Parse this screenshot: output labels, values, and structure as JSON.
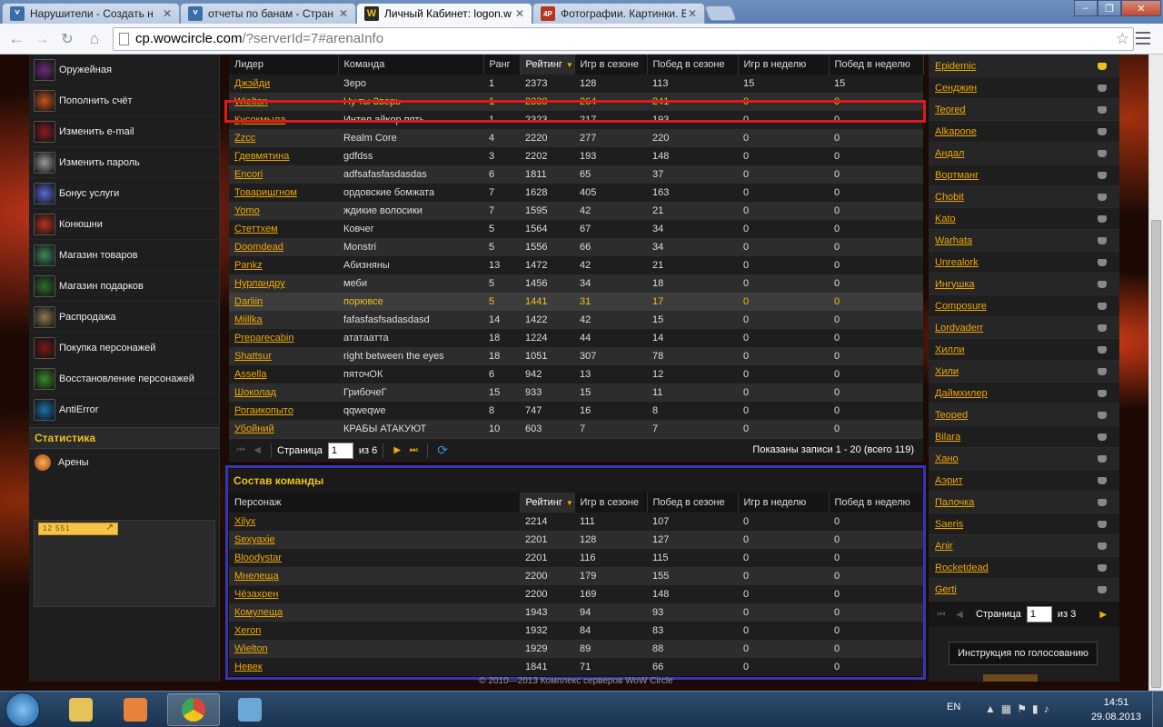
{
  "browser": {
    "tabs": [
      {
        "title": "Нарушители - Создать н",
        "favicon": "wowcircle-icon",
        "active": false
      },
      {
        "title": "отчеты по банам - Стран",
        "favicon": "wowcircle-icon",
        "active": false
      },
      {
        "title": "Личный Кабинет: logon.w",
        "favicon": "wow-icon",
        "active": true
      },
      {
        "title": "Фотографии. Картинки. В",
        "favicon": "4put-icon",
        "active": false
      }
    ],
    "url_host": "cp.wowcircle.com",
    "url_path": "/?serverId=7#arenaInfo",
    "window_controls": {
      "minimize": "‒",
      "maximize": "❐",
      "close": "✕"
    }
  },
  "left_menu": {
    "items": [
      {
        "label": "Оружейная",
        "icon": "armory-icon",
        "color": "#6b2d7a"
      },
      {
        "label": "Пополнить счёт",
        "icon": "topup-icon",
        "color": "#c4571a"
      },
      {
        "label": "Изменить e-mail",
        "icon": "email-icon",
        "color": "#8a1c1c"
      },
      {
        "label": "Изменить пароль",
        "icon": "password-icon",
        "color": "#9a9a9a"
      },
      {
        "label": "Бонус услуги",
        "icon": "bonus-icon",
        "color": "#5b6bd8"
      },
      {
        "label": "Конюшни",
        "icon": "stable-icon",
        "color": "#b8351c"
      },
      {
        "label": "Магазин товаров",
        "icon": "shop-icon",
        "color": "#3e8a5a"
      },
      {
        "label": "Магазин подарков",
        "icon": "gift-icon",
        "color": "#2f6e2a"
      },
      {
        "label": "Распродажа",
        "icon": "sale-icon",
        "color": "#8c7a55"
      },
      {
        "label": "Покупка персонажей",
        "icon": "buy-character-icon",
        "color": "#7a1a1a"
      },
      {
        "label": "Восстановление персонажей",
        "icon": "restore-character-icon",
        "color": "#3b8a2a"
      },
      {
        "label": "AntiError",
        "icon": "antierror-icon",
        "color": "#1f6fa8"
      }
    ],
    "section_title": "Статистика",
    "sub_items": [
      {
        "label": "Арены",
        "icon": "arena-icon"
      }
    ],
    "counter_text": "12 551"
  },
  "teams_table": {
    "columns": [
      "Лидер",
      "Команда",
      "Ранг",
      "Рейтинг",
      "Игр в сезоне",
      "Побед в сезоне",
      "Игр в неделю",
      "Побед в неделю"
    ],
    "sorted_column": "Рейтинг",
    "rows": [
      [
        "Джэйди",
        "Зеро",
        "1",
        "2373",
        "128",
        "113",
        "15",
        "15"
      ],
      [
        "Wielton",
        "Ну ты Зверь",
        "1",
        "2330",
        "264",
        "241",
        "0",
        "0"
      ],
      [
        "Кусокмыла",
        "Интел айкор пять",
        "1",
        "2323",
        "217",
        "193",
        "0",
        "0"
      ],
      [
        "Zzcc",
        "Realm Core",
        "4",
        "2220",
        "277",
        "220",
        "0",
        "0"
      ],
      [
        "Гдевмятина",
        "gdfdss",
        "3",
        "2202",
        "193",
        "148",
        "0",
        "0"
      ],
      [
        "Encori",
        "adfsafasfasdasdas",
        "6",
        "1811",
        "65",
        "37",
        "0",
        "0"
      ],
      [
        "Товарищгном",
        "ордовские бомжата",
        "7",
        "1628",
        "405",
        "163",
        "0",
        "0"
      ],
      [
        "Yomo",
        "ждикие волосики",
        "7",
        "1595",
        "42",
        "21",
        "0",
        "0"
      ],
      [
        "Стеттхем",
        "Ковчег",
        "5",
        "1564",
        "67",
        "34",
        "0",
        "0"
      ],
      [
        "Doomdead",
        "Monstri",
        "5",
        "1556",
        "66",
        "34",
        "0",
        "0"
      ],
      [
        "Pankz",
        "Абизняны",
        "13",
        "1472",
        "42",
        "21",
        "0",
        "0"
      ],
      [
        "Нурландру",
        "меби",
        "5",
        "1456",
        "34",
        "18",
        "0",
        "0"
      ],
      [
        "Darliin",
        "порювсе",
        "5",
        "1441",
        "31",
        "17",
        "0",
        "0"
      ],
      [
        "Miillka",
        "fafasfasfsadasdasd",
        "14",
        "1422",
        "42",
        "15",
        "0",
        "0"
      ],
      [
        "Preparecabin",
        "ататаатта",
        "18",
        "1224",
        "44",
        "14",
        "0",
        "0"
      ],
      [
        "Shattsur",
        "right between the eyes",
        "18",
        "1051",
        "307",
        "78",
        "0",
        "0"
      ],
      [
        "Assella",
        "пяточОК",
        "6",
        "942",
        "13",
        "12",
        "0",
        "0"
      ],
      [
        "Шоколад",
        "ГрибочеГ",
        "15",
        "933",
        "15",
        "11",
        "0",
        "0"
      ],
      [
        "Рогаикопыто",
        "qqweqwe",
        "8",
        "747",
        "16",
        "8",
        "0",
        "0"
      ],
      [
        "Убойний",
        "КРАБЫ АТАКУЮТ",
        "10",
        "603",
        "7",
        "7",
        "0",
        "0"
      ]
    ],
    "highlighted_row_index": 12,
    "pager": {
      "page_label": "Страница",
      "page_value": "1",
      "of_label": "из 6",
      "total_label": "Показаны записи 1 - 20 (всего 119)"
    }
  },
  "composition": {
    "title": "Состав команды",
    "columns": [
      "Персонаж",
      "Рейтинг",
      "Игр в сезоне",
      "Побед в сезоне",
      "Игр в неделю",
      "Побед в неделю"
    ],
    "sorted_column": "Рейтинг",
    "rows": [
      [
        "Xilyx",
        "2214",
        "111",
        "107",
        "0",
        "0"
      ],
      [
        "Sexyaxie",
        "2201",
        "128",
        "127",
        "0",
        "0"
      ],
      [
        "Bloodystar",
        "2201",
        "116",
        "115",
        "0",
        "0"
      ],
      [
        "Мнелеща",
        "2200",
        "179",
        "155",
        "0",
        "0"
      ],
      [
        "Чёзахрен",
        "2200",
        "169",
        "148",
        "0",
        "0"
      ],
      [
        "Комулеща",
        "1943",
        "94",
        "93",
        "0",
        "0"
      ],
      [
        "Xeron",
        "1932",
        "84",
        "83",
        "0",
        "0"
      ],
      [
        "Wielton",
        "1929",
        "89",
        "88",
        "0",
        "0"
      ],
      [
        "Невек",
        "1841",
        "71",
        "66",
        "0",
        "0"
      ]
    ]
  },
  "footer": {
    "text": "© 2010—2013 Комплекс серверов WoW Circle"
  },
  "right_sidebar": {
    "items": [
      "Epidemic",
      "Сенджин",
      "Teored",
      "Alkapone",
      "Андал",
      "Вортманг",
      "Chobit",
      "Kato",
      "Warhata",
      "Unrealork",
      "Ингушка",
      "Composure",
      "Lordvaderr",
      "Хилли",
      "Хили",
      "Даймхилер",
      "Teoped",
      "Bilara",
      "Хано",
      "Аэрит",
      "Палочка",
      "Saeris",
      "Anir",
      "Rocketdead",
      "Gerti"
    ],
    "pager": {
      "page_label": "Страница",
      "page_value": "1",
      "of_label": "из 3"
    },
    "vote_button": "Инструкция по голосованию"
  },
  "taskbar": {
    "apps": [
      {
        "name": "explorer-icon",
        "color": "#e6c35a"
      },
      {
        "name": "media-player-icon",
        "color": "#e8813a"
      },
      {
        "name": "chrome-icon",
        "color": "#d9453a"
      },
      {
        "name": "paint-icon",
        "color": "#6aa8d8"
      }
    ],
    "language": "EN",
    "time": "14:51",
    "date": "29.08.2013"
  }
}
